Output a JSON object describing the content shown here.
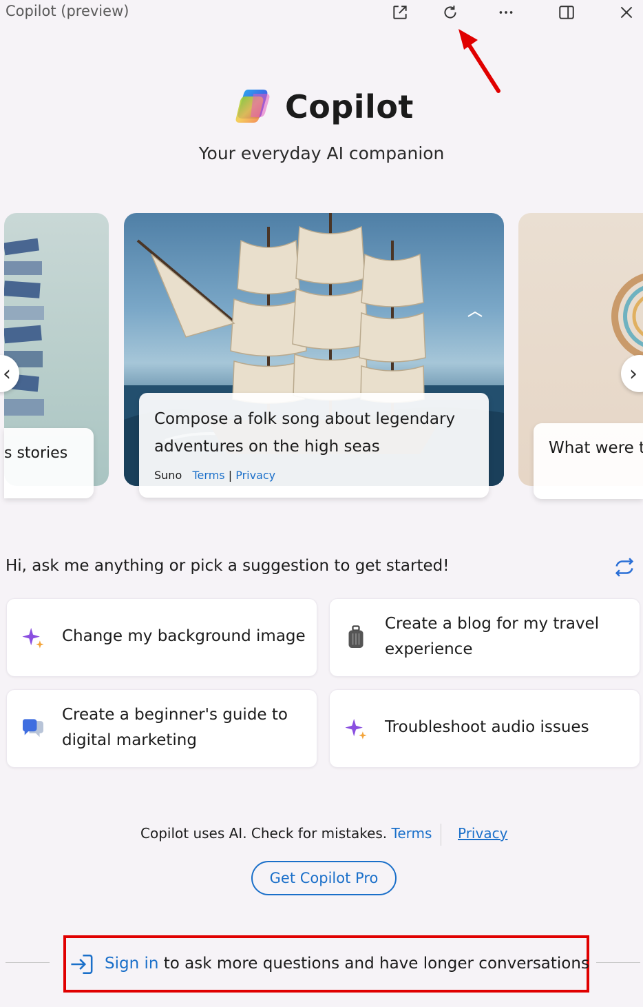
{
  "window": {
    "title": "Copilot (preview)",
    "toolbar_icons": [
      "open-external-icon",
      "refresh-icon",
      "more-icon",
      "sidebar-toggle-icon",
      "close-icon"
    ]
  },
  "header": {
    "brand": "Copilot",
    "tagline": "Your everyday AI companion"
  },
  "carousel": {
    "left_card_caption": "s stories",
    "main_card": {
      "caption": "Compose a folk song about legendary adventures on the high seas",
      "provider": "Suno",
      "terms_link": "Terms",
      "separator": "|",
      "privacy_link": "Privacy"
    },
    "right_card_caption": "What were t inventions in"
  },
  "prompt": {
    "text": "Hi, ask me anything or pick a suggestion to get started!"
  },
  "suggestions": [
    {
      "icon": "sparkle-icon",
      "label": "Change my background image"
    },
    {
      "icon": "luggage-icon",
      "label": "Create a blog for my travel experience"
    },
    {
      "icon": "chat-bubbles-icon",
      "label": "Create a beginner's guide to digital marketing"
    },
    {
      "icon": "sparkle-icon",
      "label": "Troubleshoot audio issues"
    }
  ],
  "footer": {
    "disclaimer": "Copilot uses AI. Check for mistakes.",
    "terms_link": "Terms",
    "privacy_link": "Privacy",
    "pro_button": "Get Copilot Pro",
    "signin_link": "Sign in",
    "signin_text": "to ask more questions and have longer conversations"
  },
  "colors": {
    "accent": "#1a6fc9",
    "annotation": "#e00000",
    "background": "#f6f3f7"
  }
}
